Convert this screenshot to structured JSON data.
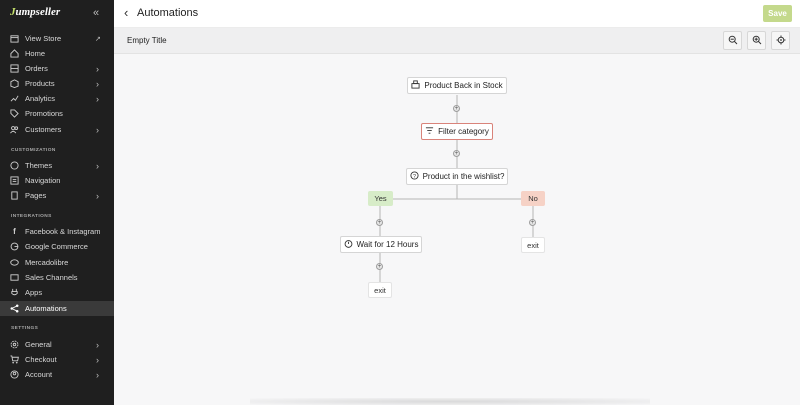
{
  "app": {
    "logo": "Jumpseller"
  },
  "sidebar": {
    "items": [
      {
        "label": "View Store",
        "icon": "store-icon"
      },
      {
        "label": "Home",
        "icon": "home-icon"
      },
      {
        "label": "Orders",
        "icon": "orders-icon"
      },
      {
        "label": "Products",
        "icon": "products-icon"
      },
      {
        "label": "Analytics",
        "icon": "analytics-icon"
      },
      {
        "label": "Promotions",
        "icon": "tag-icon"
      },
      {
        "label": "Customers",
        "icon": "customers-icon"
      },
      {
        "label": "Themes",
        "icon": "palette-icon"
      },
      {
        "label": "Navigation",
        "icon": "navigation-icon"
      },
      {
        "label": "Pages",
        "icon": "pages-icon"
      },
      {
        "label": "Facebook & Instagram",
        "icon": "facebook-icon"
      },
      {
        "label": "Google Commerce",
        "icon": "google-icon"
      },
      {
        "label": "Mercadolibre",
        "icon": "mercadolibre-icon"
      },
      {
        "label": "Sales Channels",
        "icon": "channels-icon"
      },
      {
        "label": "Apps",
        "icon": "apps-icon"
      },
      {
        "label": "Automations",
        "icon": "automations-icon"
      },
      {
        "label": "General",
        "icon": "gear-icon"
      },
      {
        "label": "Checkout",
        "icon": "cart-icon"
      },
      {
        "label": "Account",
        "icon": "account-icon"
      }
    ],
    "sections": {
      "customization": "CUSTOMIZATION",
      "integrations": "INTEGRATIONS",
      "settings": "SETTINGS"
    }
  },
  "header": {
    "title": "Automations",
    "save_label": "Save"
  },
  "toolbar": {
    "flow_title": "Empty Title"
  },
  "flow": {
    "trigger": "Product Back in Stock",
    "filter": "Filter category",
    "condition": "Product in the wishlist?",
    "yes_label": "Yes",
    "no_label": "No",
    "wait": "Wait for 12 Hours",
    "exit_yes": "exit",
    "exit_no": "exit"
  },
  "colors": {
    "sidebar_bg": "#1f1f1f",
    "save_btn": "#c4d98c",
    "filter_border": "#d9837a",
    "yes_bg": "#d7ecc8",
    "no_bg": "#f6d2c6"
  }
}
